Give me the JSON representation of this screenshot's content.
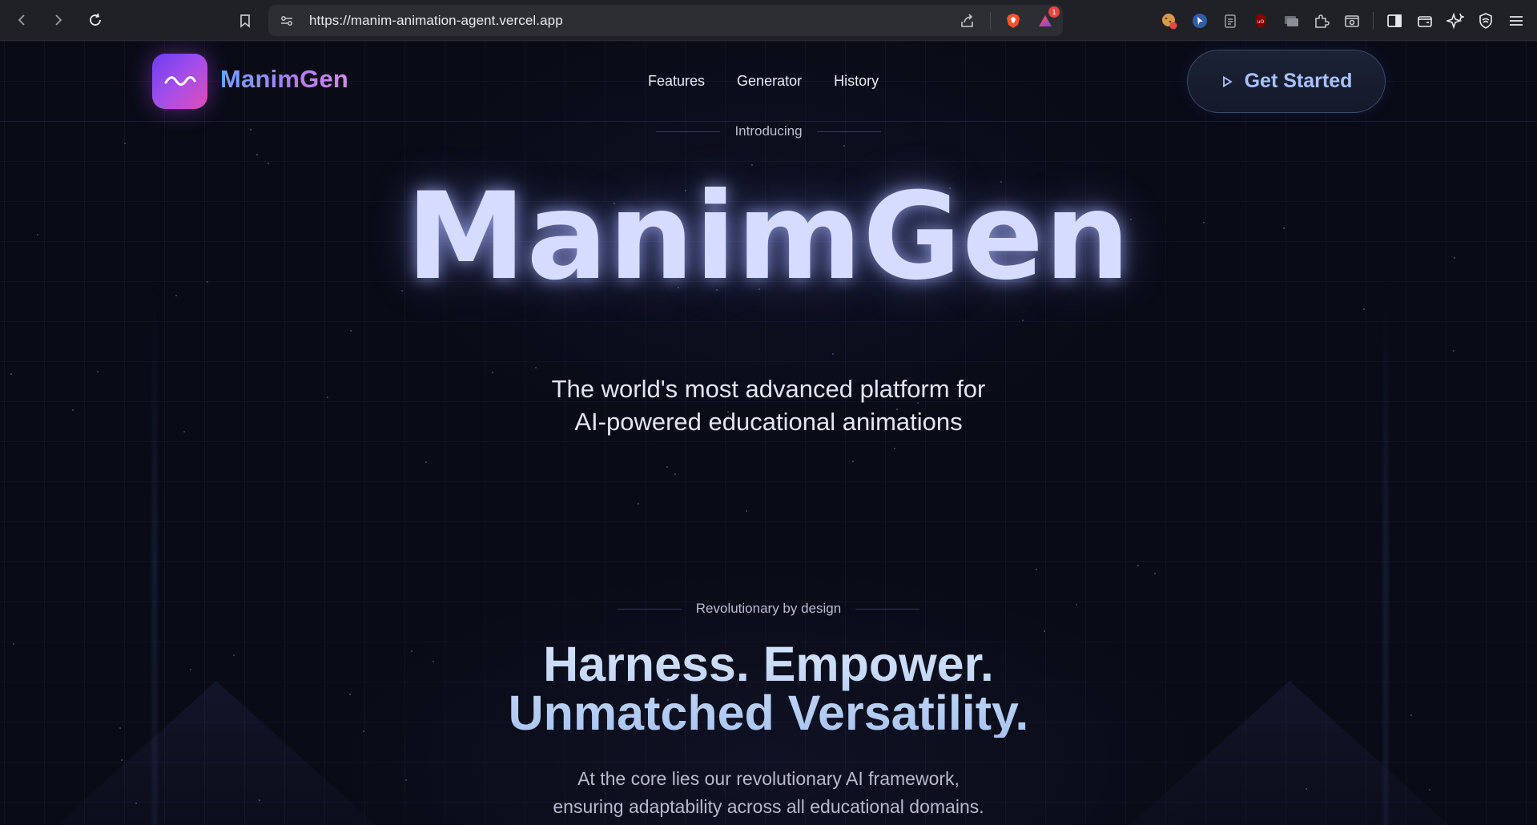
{
  "browser": {
    "url": "https://manim-animation-agent.vercel.app",
    "notification_count": "1",
    "extensions": [
      "cookie-icon",
      "cursor-icon",
      "clipboard-icon",
      "ublock-icon",
      "screen-icon",
      "puzzle-icon",
      "screenshot-icon",
      "sidebar-icon",
      "wallet-icon",
      "sparkle-icon",
      "shield-icon",
      "menu-icon"
    ]
  },
  "header": {
    "brand": "ManimGen",
    "nav": [
      "Features",
      "Generator",
      "History"
    ],
    "cta_label": "Get Started"
  },
  "hero": {
    "eyebrow": "Introducing",
    "title": "ManimGen",
    "subtitle_line1": "The world's most advanced platform for",
    "subtitle_line2": "AI-powered educational animations"
  },
  "section": {
    "eyebrow": "Revolutionary by design",
    "title_line1": "Harness. Empower.",
    "title_line2": "Unmatched Versatility.",
    "desc_line1": "At the core lies our revolutionary AI framework,",
    "desc_line2": "ensuring adaptability across all educational domains."
  },
  "colors": {
    "page_bg": "#090b16",
    "logo_gradient_start": "#6d3ef2",
    "logo_gradient_end": "#e24cb6",
    "cta_text": "#a9c1ff",
    "hero_title": "#d6dcff"
  }
}
